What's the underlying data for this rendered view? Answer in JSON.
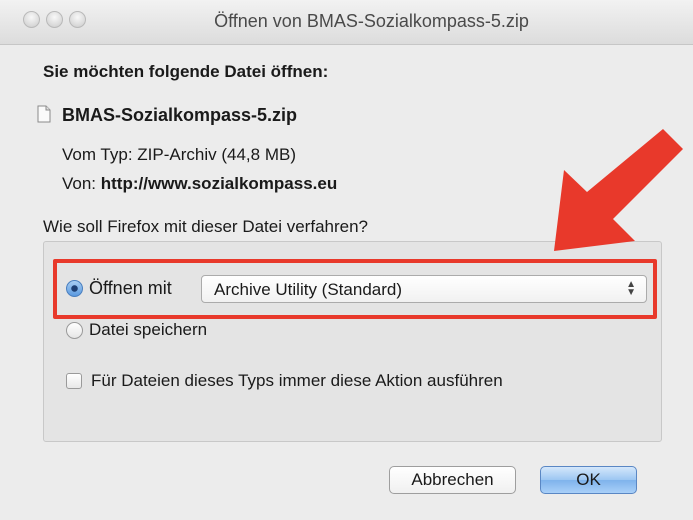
{
  "window": {
    "title": "Öffnen von BMAS-Sozialkompass-5.zip"
  },
  "dialog": {
    "prompt": "Sie möchten folgende Datei öffnen:",
    "file_name": "BMAS-Sozialkompass-5.zip",
    "type_line": "Vom Typ: ZIP-Archiv (44,8 MB)",
    "from_label": "Von: ",
    "from_url": "http://www.sozialkompass.eu",
    "question": "Wie soll Firefox mit dieser Datei verfahren?",
    "open_with_label": "Öffnen mit",
    "open_with_selected": "Archive Utility (Standard)",
    "save_label": "Datei speichern",
    "always_label": "Für Dateien dieses Typs immer diese Aktion ausführen",
    "open_with_checked": true,
    "save_checked": false,
    "always_checked": false
  },
  "buttons": {
    "cancel": "Abbrechen",
    "ok": "OK"
  },
  "annotation": {
    "color": "#e8392b"
  },
  "icons": [
    "window-close-icon",
    "window-minimize-icon",
    "window-zoom-icon",
    "file-icon",
    "select-arrows-icon",
    "annotation-arrow-icon"
  ]
}
